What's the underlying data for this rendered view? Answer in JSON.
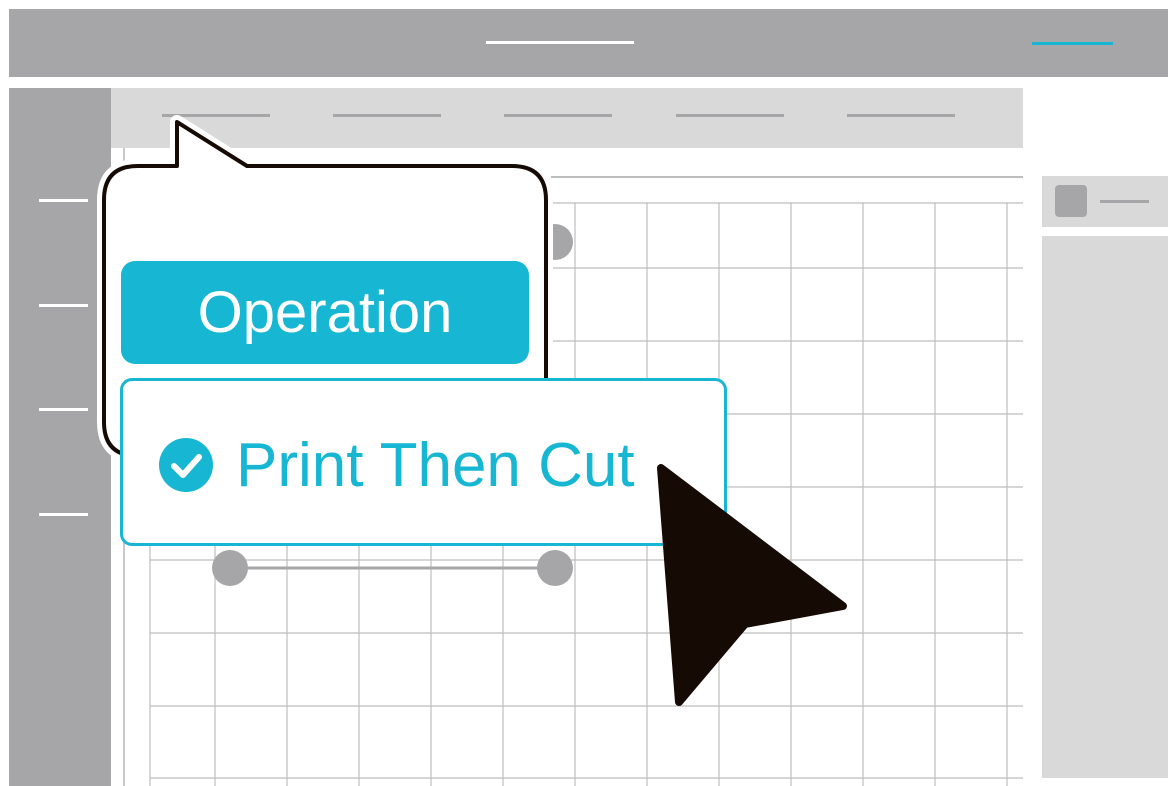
{
  "popup": {
    "operation_label": "Operation",
    "selected_option": "Print Then Cut"
  },
  "colors": {
    "accent": "#17b7d3",
    "chrome_gray": "#a6a6a8",
    "panel_gray": "#d9d9d9",
    "cursor": "#160a05"
  },
  "icons": {
    "cursor": "cursor-arrow-icon",
    "check": "check-circle-icon"
  }
}
